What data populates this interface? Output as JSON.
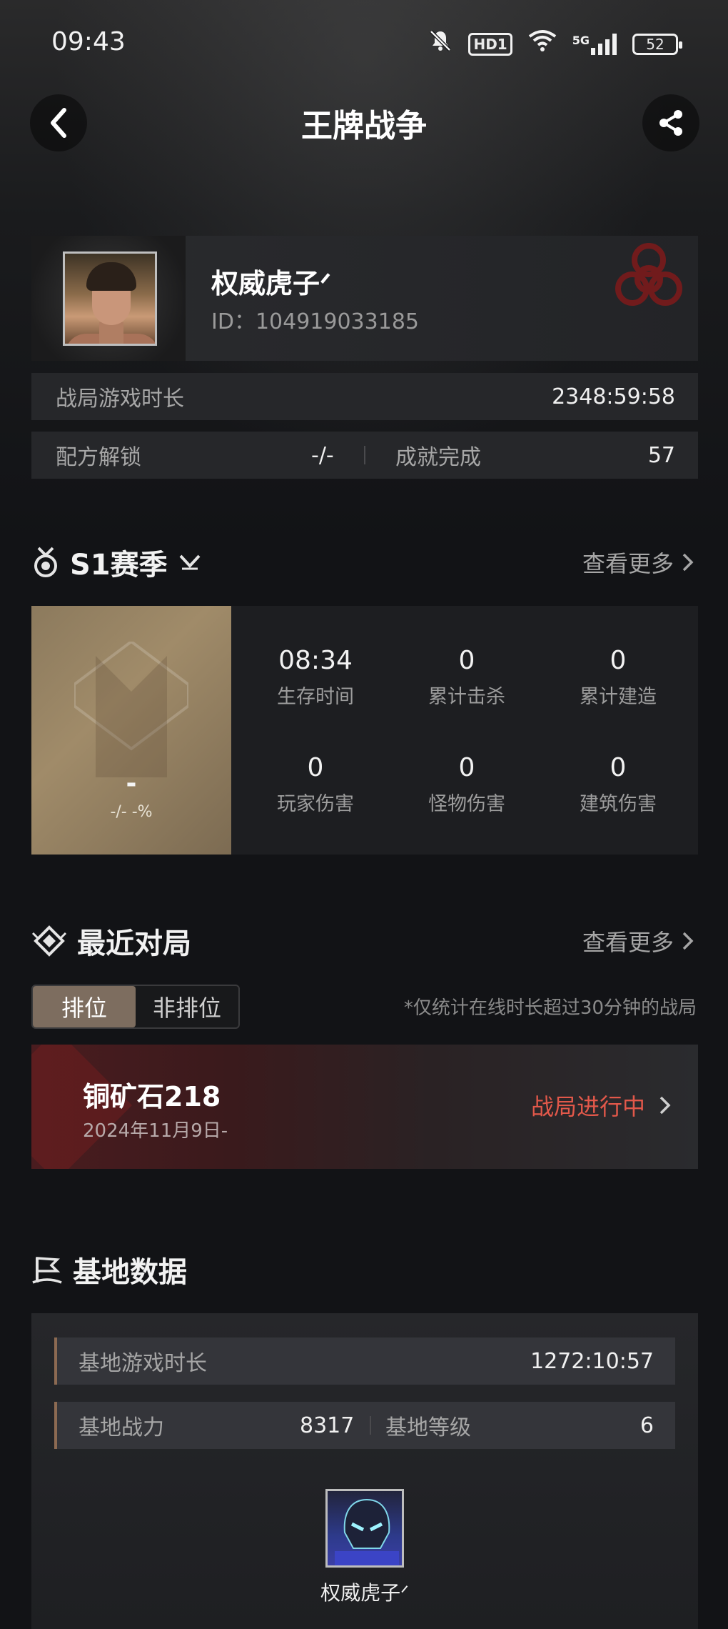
{
  "status_bar": {
    "time": "09:43",
    "hd_label": "HD1",
    "network": "5G",
    "battery": "52"
  },
  "header": {
    "title": "王牌战争"
  },
  "profile": {
    "name": "权威虎子ᐟ",
    "id_text": "ID：104919033185"
  },
  "stats": {
    "play_time_label": "战局游戏时长",
    "play_time_value": "2348:59:58",
    "recipe_label": "配方解锁",
    "recipe_value": "-/-",
    "achievement_label": "成就完成",
    "achievement_value": "57"
  },
  "season": {
    "title": "S1赛季",
    "see_more": "查看更多",
    "rank": "-",
    "rank_pct": "-/- -%",
    "items": [
      {
        "value": "08:34",
        "label": "生存时间"
      },
      {
        "value": "0",
        "label": "累计击杀"
      },
      {
        "value": "0",
        "label": "累计建造"
      },
      {
        "value": "0",
        "label": "玩家伤害"
      },
      {
        "value": "0",
        "label": "怪物伤害"
      },
      {
        "value": "0",
        "label": "建筑伤害"
      }
    ]
  },
  "recent": {
    "title": "最近对局",
    "see_more": "查看更多",
    "tab_ranked": "排位",
    "tab_unranked": "非排位",
    "note": "*仅统计在线时长超过30分钟的战局",
    "match": {
      "name": "铜矿石218",
      "date": "2024年11月9日-",
      "status": "战局进行中"
    }
  },
  "base": {
    "title": "基地数据",
    "time_label": "基地游戏时长",
    "time_value": "1272:10:57",
    "power_label": "基地战力",
    "power_value": "8317",
    "level_label": "基地等级",
    "level_value": "6",
    "owner_name": "权威虎子ᐟ"
  },
  "colors": {
    "accent_red": "#e2584a",
    "toggle_active": "#7d6d5f"
  }
}
